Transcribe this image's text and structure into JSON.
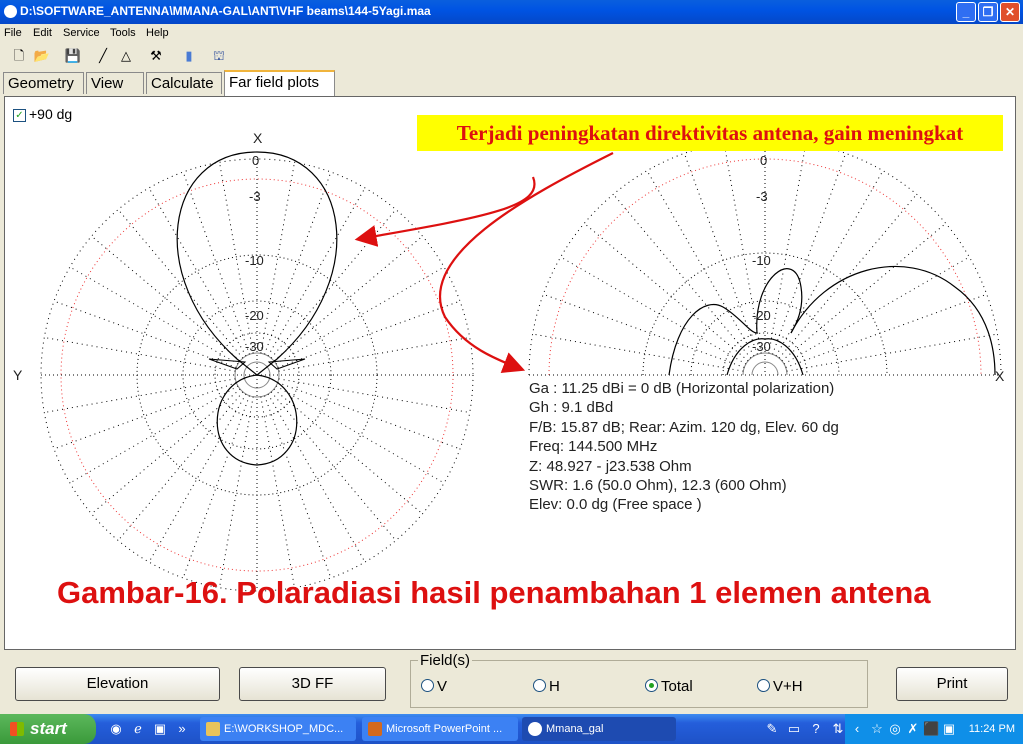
{
  "window": {
    "title": "D:\\SOFTWARE_ANTENNA\\MMANA-GAL\\ANT\\VHF beams\\144-5Yagi.maa",
    "buttons": [
      "minimize",
      "maximize",
      "close"
    ]
  },
  "menu": [
    "File",
    "Edit",
    "Service",
    "Tools",
    "Help"
  ],
  "toolbar": [
    "new-file-icon",
    "open-folder-icon",
    "save-icon",
    "draw-line-icon",
    "triangle-icon",
    "tools-icon",
    "document-icon",
    "cursor-icon"
  ],
  "tabs": [
    {
      "label": "Geometry",
      "active": false
    },
    {
      "label": "View",
      "active": false
    },
    {
      "label": "Calculate",
      "active": false
    },
    {
      "label": "Far field plots",
      "active": true
    }
  ],
  "plot": {
    "checkbox_label": "+90 dg",
    "checkbox_checked": true,
    "left_axis": {
      "top": "X",
      "left": "Y"
    },
    "right_axis": {
      "right": "X"
    },
    "ring_labels": [
      "0",
      "-3",
      "-10",
      "-20",
      "-30"
    ],
    "annotation": "Terjadi peningkatan direktivitas antena, gain meningkat",
    "info_lines": [
      "Ga : 11.25 dBi = 0 dB  (Horizontal polarization)",
      "Gh : 9.1 dBd",
      "F/B: 15.87 dB; Rear: Azim. 120 dg,  Elev. 60 dg",
      "Freq: 144.500 MHz",
      "Z: 48.927 - j23.538 Ohm",
      "SWR: 1.6 (50.0 Ohm), 12.3 (600 Ohm)",
      "Elev: 0.0 dg (Free space )"
    ],
    "caption": "Gambar-16. Polaradiasi hasil penambahan 1 elemen antena",
    "colors": {
      "annotation": "#dd1010",
      "annotation_bg": "#ffff00",
      "pattern": "#000000"
    }
  },
  "bottom": {
    "elevation_button": "Elevation",
    "ff3d_button": "3D FF",
    "fields_legend": "Field(s)",
    "fields_options": [
      "V",
      "H",
      "Total",
      "V+H"
    ],
    "fields_selected": "Total",
    "print_button": "Print"
  },
  "taskbar": {
    "start": "start",
    "windows": [
      {
        "label": "E:\\WORKSHOP_MDC...",
        "active": false
      },
      {
        "label": "Microsoft PowerPoint ...",
        "active": false
      },
      {
        "label": "Mmana_gal",
        "active": true
      }
    ],
    "time": "11:24 PM"
  }
}
